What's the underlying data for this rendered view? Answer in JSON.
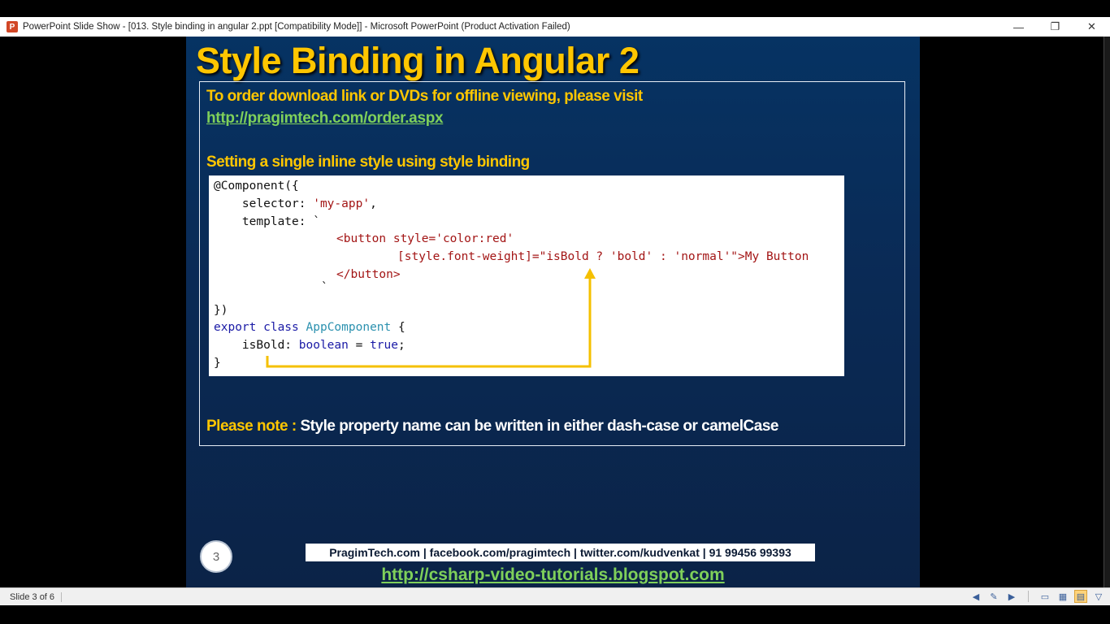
{
  "window": {
    "title": "PowerPoint Slide Show - [013. Style binding in angular 2.ppt [Compatibility Mode]] - Microsoft PowerPoint (Product Activation Failed)",
    "app_icon_letter": "P",
    "minimize": "—",
    "restore": "❐",
    "close": "✕"
  },
  "slide": {
    "title": "Style Binding in Angular 2",
    "order_text": "To order download link or DVDs for offline viewing, please visit",
    "order_link": "http://pragimtech.com/order.aspx",
    "subheading": "Setting a single inline style using style binding",
    "code": {
      "l1": "@Component({",
      "l2a": "    selector: ",
      "l2b": "'my-app'",
      "l2c": ",",
      "l3": "    template: `",
      "l4": "<button style='color:red'",
      "l5": "[style.font-weight]=\"isBold ? 'bold' : 'normal'\">My Button",
      "l6": "</button>",
      "l7": "`",
      "l8": "})",
      "l9a": "export class ",
      "l9b": "AppComponent",
      "l9c": " {",
      "l10a": "    isBold: ",
      "l10b": "boolean",
      "l10c": " = ",
      "l10d": "true",
      "l10e": ";",
      "l11": "}"
    },
    "note_label": "Please note : ",
    "note_text": "Style property name can be written in either dash-case or camelCase",
    "slide_number": "3",
    "footer_text": "PragimTech.com | facebook.com/pragimtech  | twitter.com/kudvenkat  | 91 99456 99393",
    "footer_link": "http://csharp-video-tutorials.blogspot.com"
  },
  "statusbar": {
    "slide_count": "Slide 3 of 6"
  },
  "colors": {
    "title": "#ffc600",
    "link": "#7fd05a",
    "arrow": "#f5c000"
  }
}
